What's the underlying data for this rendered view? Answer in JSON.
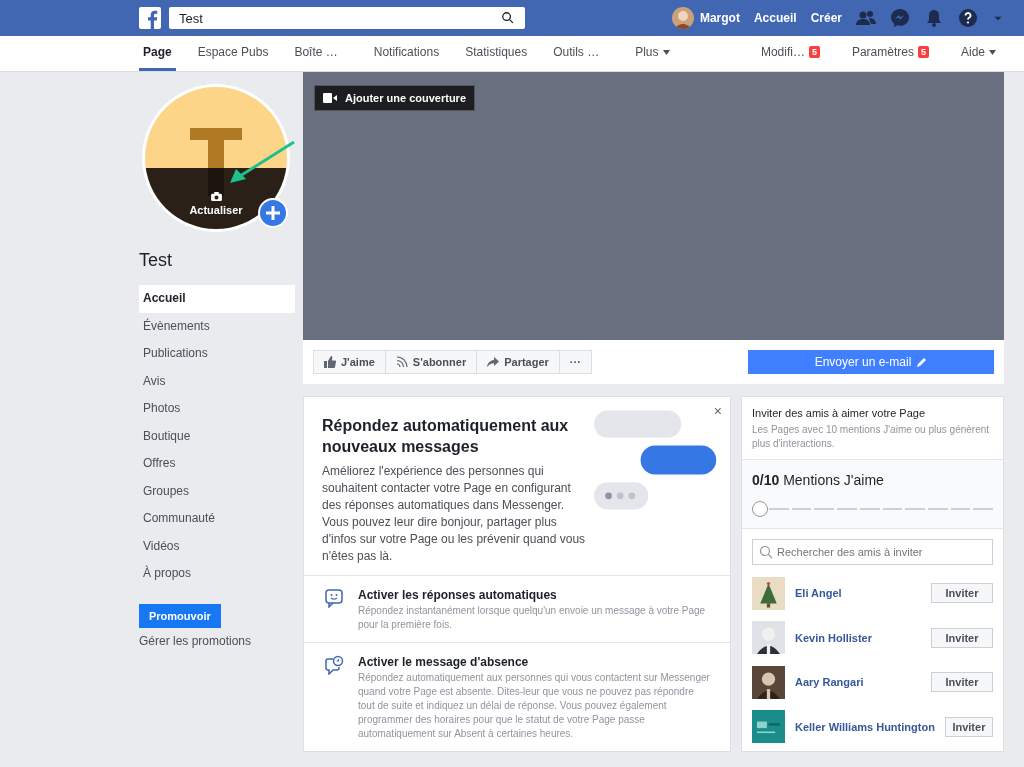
{
  "top_bar": {
    "search": {
      "value": "Test"
    },
    "user": "Margot",
    "links": [
      "Accueil",
      "Créer"
    ]
  },
  "page_nav": {
    "tabs": [
      {
        "label": "Page",
        "selected": true,
        "caret": false
      },
      {
        "label": "Espace Pubs",
        "selected": false,
        "caret": false
      },
      {
        "label": "Boîte …",
        "selected": false,
        "caret": false
      },
      {
        "label": "Notifications",
        "selected": false,
        "caret": false
      },
      {
        "label": "Statistiques",
        "selected": false,
        "caret": false
      },
      {
        "label": "Outils …",
        "selected": false,
        "caret": false
      },
      {
        "label": "Plus",
        "selected": false,
        "caret": true
      }
    ],
    "right": [
      {
        "label": "Modifi…",
        "badge": "5",
        "caret": false
      },
      {
        "label": "Paramètres",
        "badge": "5",
        "caret": false
      },
      {
        "label": "Aide",
        "caret": true
      }
    ]
  },
  "sidebar": {
    "profile_label": "Actualiser",
    "page_name": "Test",
    "items": [
      {
        "label": "Accueil",
        "selected": true
      },
      {
        "label": "Évènements",
        "selected": false
      },
      {
        "label": "Publications",
        "selected": false
      },
      {
        "label": "Avis",
        "selected": false
      },
      {
        "label": "Photos",
        "selected": false
      },
      {
        "label": "Boutique",
        "selected": false
      },
      {
        "label": "Offres",
        "selected": false
      },
      {
        "label": "Groupes",
        "selected": false
      },
      {
        "label": "Communauté",
        "selected": false
      },
      {
        "label": "Vidéos",
        "selected": false
      },
      {
        "label": "À propos",
        "selected": false
      }
    ],
    "promote_button": "Promouvoir",
    "manage_link": "Gérer les promotions"
  },
  "cover": {
    "add_button": "Ajouter une couverture"
  },
  "actions": [
    {
      "kind": "like",
      "label": "J'aime"
    },
    {
      "kind": "follow",
      "label": "S'abonner"
    },
    {
      "kind": "share",
      "label": "Partager"
    },
    {
      "kind": "more",
      "label": "···"
    }
  ],
  "email_button": "Envoyer un e-mail",
  "auto_reply": {
    "title": "Répondez automatiquement aux nouveaux messages",
    "body": "Améliorez l'expérience des personnes qui souhaitent contacter votre Page en configurant des réponses automatiques dans Messenger. Vous pouvez leur dire bonjour, partager plus d'infos sur votre Page ou les prévenir quand vous n'êtes pas là.",
    "close": "×",
    "options": [
      {
        "kind": "smile",
        "title": "Activer les réponses automatiques",
        "text": "Répondez instantanément lorsque quelqu'un envoie un message à votre Page pour la première fois."
      },
      {
        "kind": "away",
        "title": "Activer le message d'absence",
        "text": "Répondez automatiquement aux personnes qui vous contactent sur Messenger quand votre Page est absente. Dites-leur que vous ne pouvez pas répondre tout de suite et indiquez un délai de réponse. Vous pouvez également programmer des horaires pour que le statut de votre Page passe automatiquement sur Absent à certaines heures."
      }
    ]
  },
  "invite": {
    "title": "Inviter des amis à aimer votre Page",
    "subtitle": "Les Pages avec 10 mentions J'aime ou plus génèrent plus d'interactions.",
    "count": "0/10",
    "count_label": "Mentions J'aime",
    "level": 0,
    "search": {
      "placeholder": "Rechercher des amis à inviter"
    },
    "friends": [
      {
        "name": "Eli Angel",
        "button": "Inviter"
      },
      {
        "name": "Kevin Hollister",
        "button": "Inviter"
      },
      {
        "name": "Aary Rangari",
        "button": "Inviter"
      },
      {
        "name": "Keller Williams Huntington",
        "button": "Inviter"
      }
    ]
  }
}
